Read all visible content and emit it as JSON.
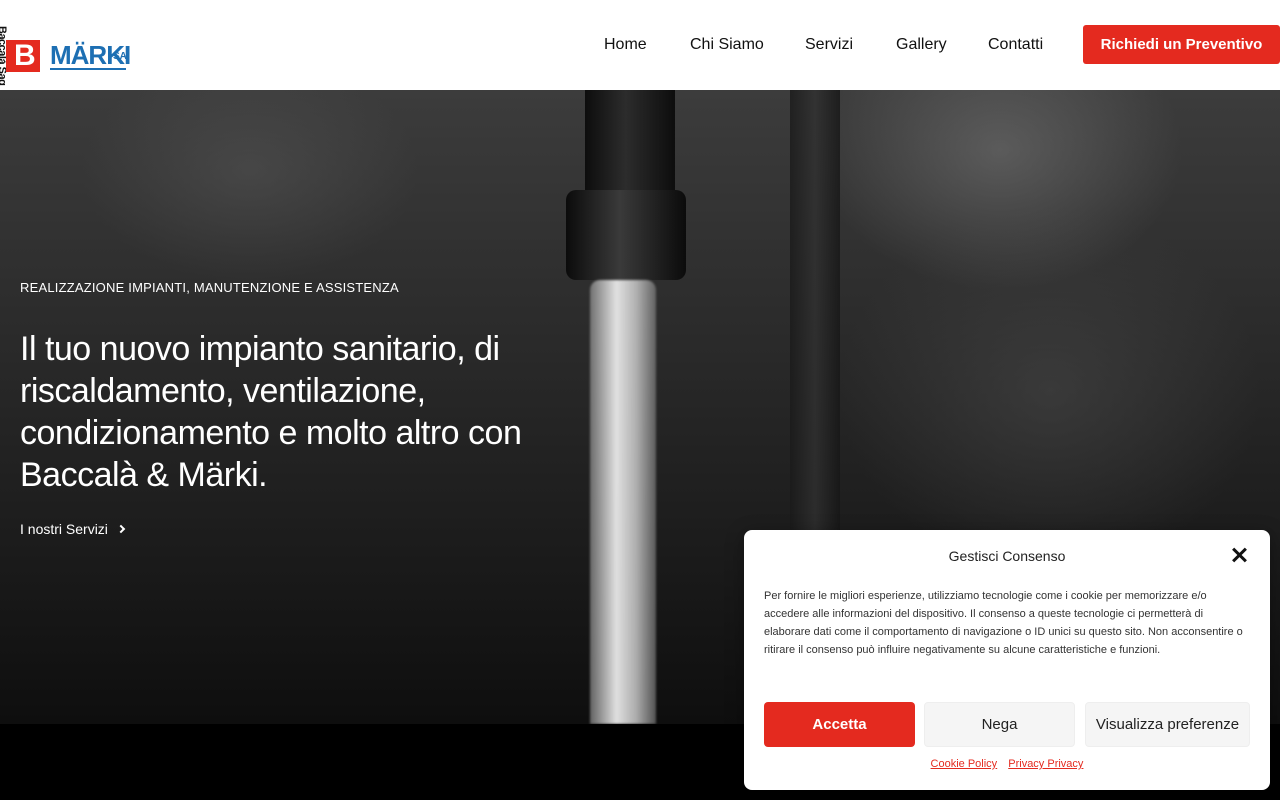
{
  "header": {
    "logo": {
      "vertical_text": "Baccalà Sag",
      "mark_letter": "B",
      "brand": "MÄRKI",
      "suffix": "SA"
    },
    "nav": [
      {
        "label": "Home"
      },
      {
        "label": "Chi Siamo"
      },
      {
        "label": "Servizi"
      },
      {
        "label": "Gallery"
      },
      {
        "label": "Contatti"
      }
    ],
    "cta_label": "Richiedi un Preventivo"
  },
  "hero": {
    "subtitle": "REALIZZAZIONE IMPIANTI, MANUTENZIONE E ASSISTENZA",
    "headline": "Il tuo nuovo impianto sanitario, di riscaldamento, ventilazione, condizionamento e molto altro con Baccalà & Märki.",
    "link_label": "I nostri Servizi"
  },
  "consent": {
    "title": "Gestisci Consenso",
    "text": "Per fornire le migliori esperienze, utilizziamo tecnologie come i cookie per memorizzare e/o accedere alle informazioni del dispositivo. Il consenso a queste tecnologie ci permetterà di elaborare dati come il comportamento di navigazione o ID unici su questo sito. Non acconsentire o ritirare il consenso può influire negativamente su alcune caratteristiche e funzioni.",
    "accept_label": "Accetta",
    "deny_label": "Nega",
    "prefs_label": "Visualizza preferenze",
    "cookie_policy_label": "Cookie Policy",
    "privacy_label": "Privacy Privacy"
  },
  "colors": {
    "accent": "#e42a1f",
    "brand_blue": "#1d6fb3"
  }
}
